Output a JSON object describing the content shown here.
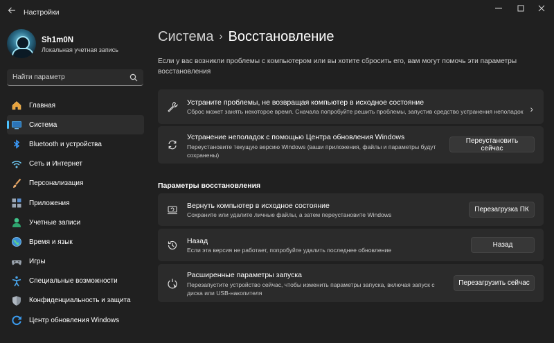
{
  "app": {
    "title": "Настройки"
  },
  "user": {
    "name": "Sh1m0N",
    "account_type": "Локальная учетная запись"
  },
  "search": {
    "placeholder": "Найти параметр"
  },
  "sidebar": {
    "items": [
      {
        "label": "Главная",
        "icon": "home-icon"
      },
      {
        "label": "Система",
        "icon": "system-icon",
        "active": true
      },
      {
        "label": "Bluetooth и устройства",
        "icon": "bluetooth-icon"
      },
      {
        "label": "Сеть и Интернет",
        "icon": "wifi-icon"
      },
      {
        "label": "Персонализация",
        "icon": "brush-icon"
      },
      {
        "label": "Приложения",
        "icon": "apps-icon"
      },
      {
        "label": "Учетные записи",
        "icon": "account-icon"
      },
      {
        "label": "Время и язык",
        "icon": "globe-icon"
      },
      {
        "label": "Игры",
        "icon": "gamepad-icon"
      },
      {
        "label": "Специальные возможности",
        "icon": "accessibility-icon"
      },
      {
        "label": "Конфиденциальность и защита",
        "icon": "shield-icon"
      },
      {
        "label": "Центр обновления Windows",
        "icon": "update-icon"
      }
    ]
  },
  "header": {
    "parent": "Система",
    "separator": "›",
    "current": "Восстановление"
  },
  "description": "Если у вас возникли проблемы с компьютером или вы хотите сбросить его, вам могут помочь эти параметры восстановления",
  "cards": {
    "fix_problems": {
      "title": "Устраните проблемы, не возвращая компьютер в исходное состояние",
      "desc": "Сброс может занять некоторое время. Сначала попробуйте решить проблемы, запустив средство устранения неполадок",
      "chevron": "›"
    },
    "fix_update": {
      "title": "Устранение неполадок с помощью Центра обновления Windows",
      "desc": "Переустановите текущую версию Windows (ваши приложения, файлы и параметры будут сохранены)",
      "button": "Переустановить сейчас"
    }
  },
  "recovery": {
    "section_title": "Параметры восстановления",
    "reset": {
      "title": "Вернуть компьютер в исходное состояние",
      "desc": "Сохраните или удалите личные файлы, а затем переустановите Windows",
      "button": "Перезагрузка ПК"
    },
    "go_back": {
      "title": "Назад",
      "desc": "Если эта версия не работает, попробуйте удалить последнее обновление",
      "button": "Назад"
    },
    "advanced": {
      "title": "Расширенные параметры запуска",
      "desc": "Перезапустите устройство сейчас, чтобы изменить параметры запуска, включая запуск с диска или USB-накопителя",
      "button": "Перезагрузить сейчас"
    }
  },
  "colors": {
    "accent": "#4cc2ff",
    "background": "#202020",
    "card": "#2b2b2b"
  }
}
